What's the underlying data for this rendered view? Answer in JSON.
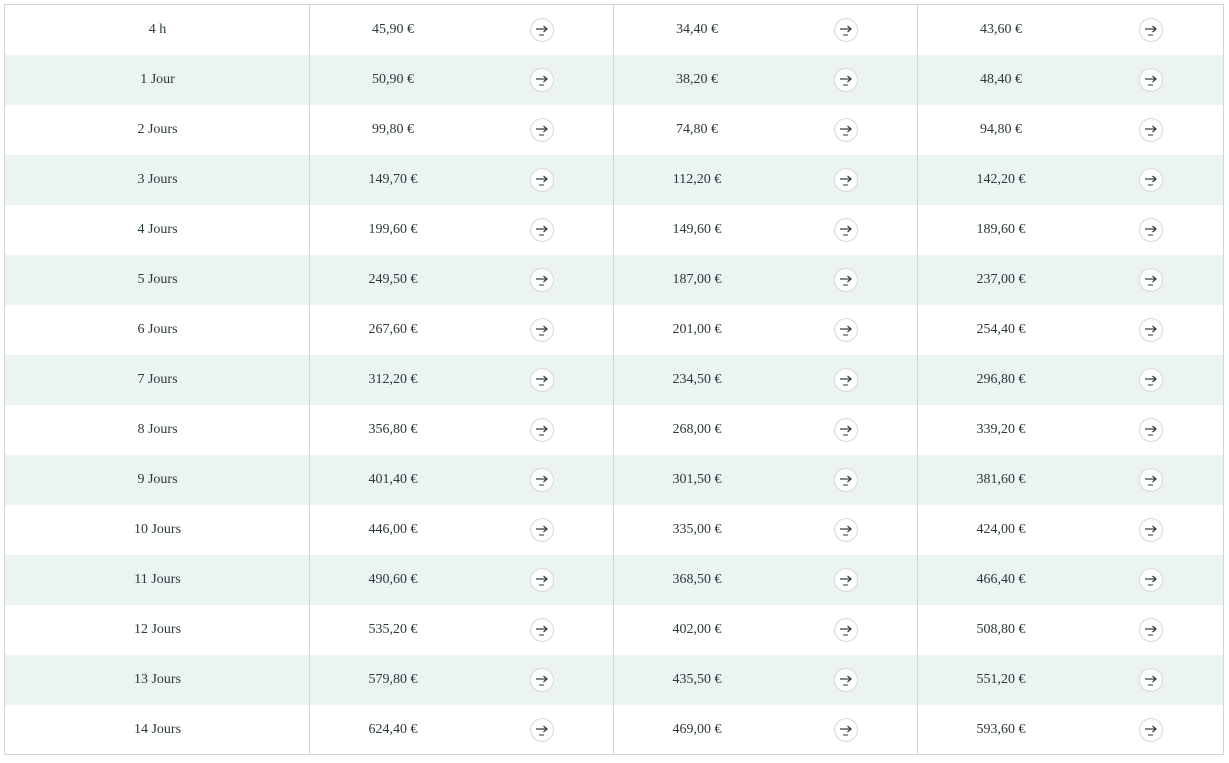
{
  "table": {
    "icon": "arrow-right-icon",
    "rows": [
      {
        "duration": "4 h",
        "prices": [
          "45,90 €",
          "34,40 €",
          "43,60 €"
        ]
      },
      {
        "duration": "1 Jour",
        "prices": [
          "50,90 €",
          "38,20 €",
          "48,40 €"
        ]
      },
      {
        "duration": "2 Jours",
        "prices": [
          "99,80 €",
          "74,80 €",
          "94,80 €"
        ]
      },
      {
        "duration": "3 Jours",
        "prices": [
          "149,70 €",
          "112,20 €",
          "142,20 €"
        ]
      },
      {
        "duration": "4 Jours",
        "prices": [
          "199,60 €",
          "149,60 €",
          "189,60 €"
        ]
      },
      {
        "duration": "5 Jours",
        "prices": [
          "249,50 €",
          "187,00 €",
          "237,00 €"
        ]
      },
      {
        "duration": "6 Jours",
        "prices": [
          "267,60 €",
          "201,00 €",
          "254,40 €"
        ]
      },
      {
        "duration": "7 Jours",
        "prices": [
          "312,20 €",
          "234,50 €",
          "296,80 €"
        ]
      },
      {
        "duration": "8 Jours",
        "prices": [
          "356,80 €",
          "268,00 €",
          "339,20 €"
        ]
      },
      {
        "duration": "9 Jours",
        "prices": [
          "401,40 €",
          "301,50 €",
          "381,60 €"
        ]
      },
      {
        "duration": "10 Jours",
        "prices": [
          "446,00 €",
          "335,00 €",
          "424,00 €"
        ]
      },
      {
        "duration": "11 Jours",
        "prices": [
          "490,60 €",
          "368,50 €",
          "466,40 €"
        ]
      },
      {
        "duration": "12 Jours",
        "prices": [
          "535,20 €",
          "402,00 €",
          "508,80 €"
        ]
      },
      {
        "duration": "13 Jours",
        "prices": [
          "579,80 €",
          "435,50 €",
          "551,20 €"
        ]
      },
      {
        "duration": "14 Jours",
        "prices": [
          "624,40 €",
          "469,00 €",
          "593,60 €"
        ]
      }
    ]
  },
  "colors": {
    "row_alt_background": "#ebf3f3",
    "text": "#2b3a38",
    "border": "#cfd6d5"
  }
}
